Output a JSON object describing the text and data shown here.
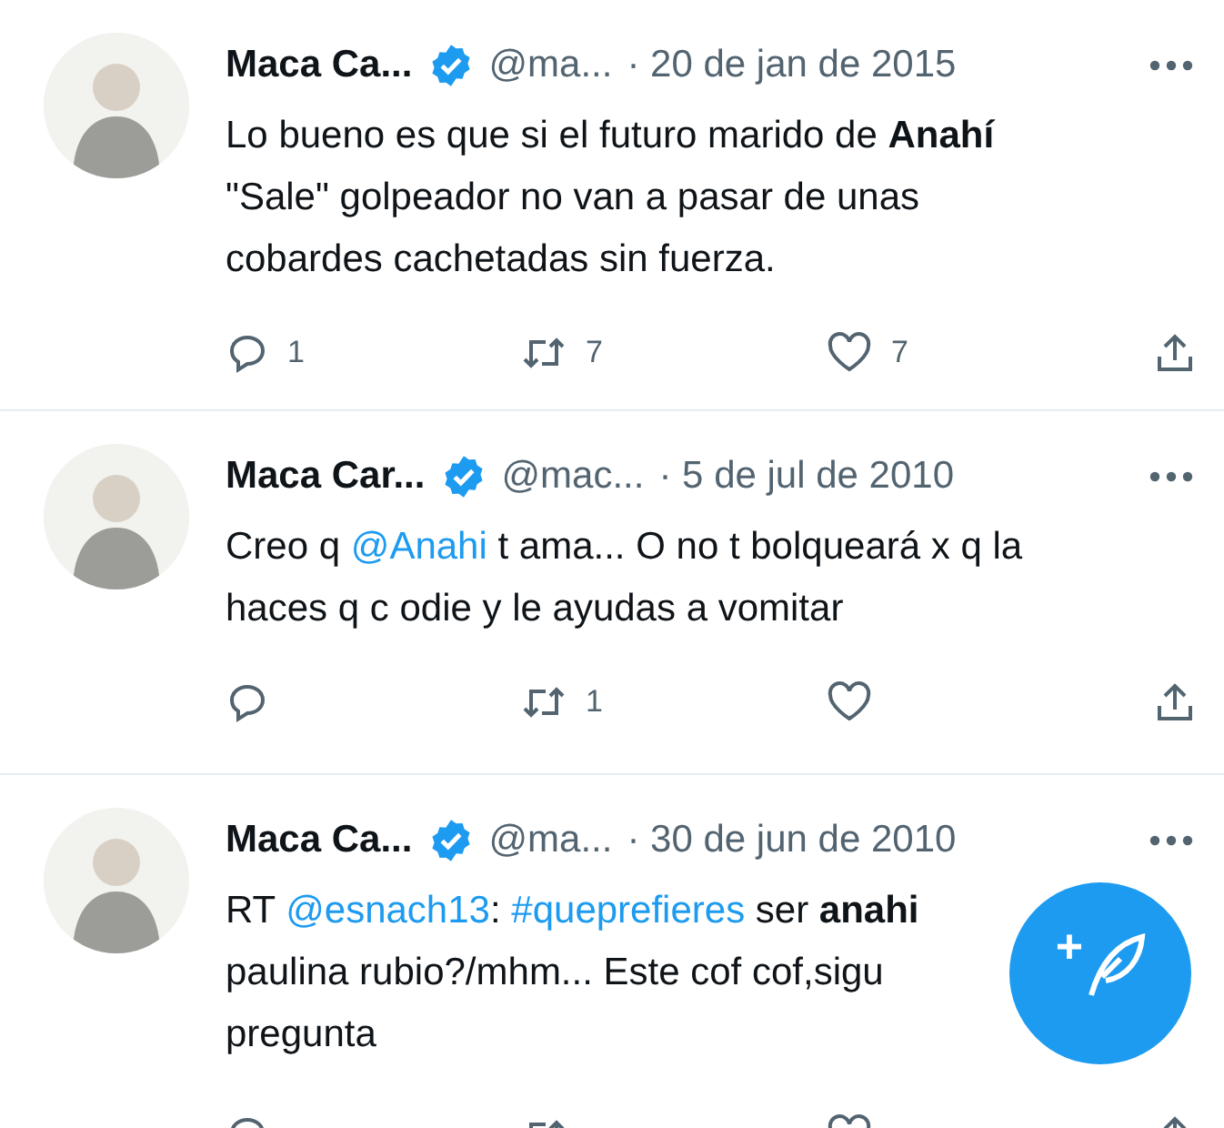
{
  "tweets": [
    {
      "name": "Maca Ca...",
      "verified": true,
      "handle": "@ma...",
      "date": "· 20 de jan de 2015",
      "body": [
        [
          {
            "kind": "text",
            "text": "Lo bueno es que si el futuro marido de "
          },
          {
            "kind": "bold",
            "text": "Anahí"
          }
        ],
        [
          {
            "kind": "text",
            "text": "\"Sale\" golpeador no van a pasar de unas"
          }
        ],
        [
          {
            "kind": "text",
            "text": "cobardes cachetadas sin fuerza."
          }
        ]
      ],
      "replies": "1",
      "retweets": "7",
      "likes": "7"
    },
    {
      "name": "Maca Car...",
      "verified": true,
      "handle": "@mac...",
      "date": "· 5 de jul de 2010",
      "body": [
        [
          {
            "kind": "text",
            "text": "Creo q "
          },
          {
            "kind": "mention",
            "text": "@Anahi"
          },
          {
            "kind": "text",
            "text": " t ama... O no t bolqueará x q la"
          }
        ],
        [
          {
            "kind": "text",
            "text": "haces q c odie y le ayudas a vomitar"
          }
        ]
      ],
      "retweets": "1"
    },
    {
      "name": "Maca Ca...",
      "verified": true,
      "handle": "@ma...",
      "date": "· 30 de jun de 2010",
      "body": [
        [
          {
            "kind": "text",
            "text": "RT "
          },
          {
            "kind": "mention",
            "text": "@esnach13"
          },
          {
            "kind": "text",
            "text": ": "
          },
          {
            "kind": "hashtag",
            "text": "#queprefieres"
          },
          {
            "kind": "text",
            "text": "  ser "
          },
          {
            "kind": "bold",
            "text": "anahi"
          }
        ],
        [
          {
            "kind": "text",
            "text": "paulina rubio?/mhm... Este cof cof,sigu"
          }
        ],
        [
          {
            "kind": "text",
            "text": "pregunta"
          }
        ]
      ]
    }
  ],
  "compose_button": {
    "label": "+"
  }
}
